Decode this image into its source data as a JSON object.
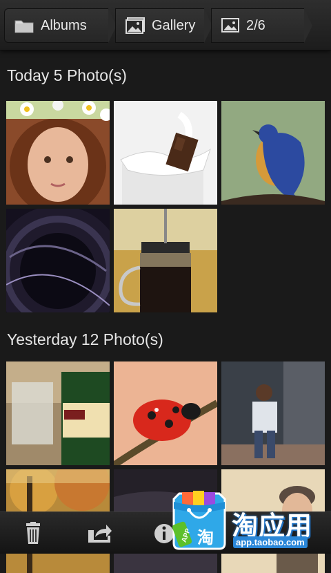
{
  "breadcrumb": {
    "albums": {
      "label": "Albums",
      "icon": "folder-icon"
    },
    "gallery": {
      "label": "Gallery",
      "icon": "image-icon"
    },
    "position": {
      "label": "2/6",
      "icon": "image-icon"
    }
  },
  "sections": [
    {
      "title": "Today 5 Photo(s)",
      "photos": [
        "girl-with-flower-crown",
        "chocolate-milk-splash",
        "blue-bird-on-branch",
        "camera-lens",
        "french-press-coffee"
      ]
    },
    {
      "title": "Yesterday 12 Photo(s)",
      "photos": [
        "glass-and-green-bottle",
        "ladybug-with-dew",
        "boy-walking",
        "autumn-trees",
        "dark-fur",
        "smiling-child"
      ]
    }
  ],
  "bottombar": {
    "delete_icon": "trash-icon",
    "share_icon": "share-icon",
    "info_icon": "info-icon"
  },
  "promo": {
    "title": "淘应用",
    "url": "app.taobao.com",
    "badge": "APP",
    "bag_label": "淘"
  },
  "colors": {
    "background": "#1a1a1a",
    "bar": "#262626",
    "text": "#e6e6e6",
    "promo_blue": "#2b87d8"
  }
}
